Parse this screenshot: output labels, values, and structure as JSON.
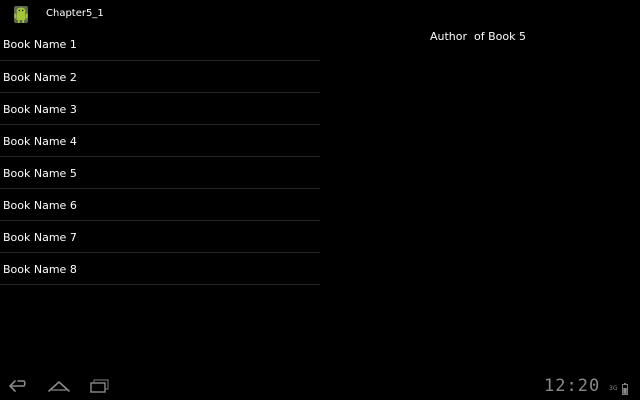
{
  "action_bar": {
    "app_icon": "android-robot-icon",
    "title": "Chapter5_1"
  },
  "book_list": {
    "items": [
      {
        "label": "Book Name 1"
      },
      {
        "label": "Book Name 2"
      },
      {
        "label": "Book Name 3"
      },
      {
        "label": "Book Name 4"
      },
      {
        "label": "Book Name 5"
      },
      {
        "label": "Book Name 6"
      },
      {
        "label": "Book Name 7"
      },
      {
        "label": "Book Name 8"
      }
    ]
  },
  "detail": {
    "author_text": "Author  of Book 5"
  },
  "system_bar": {
    "nav_icons": [
      "back-icon",
      "home-icon",
      "recent-apps-icon"
    ],
    "clock": "12:20",
    "signal": "3G",
    "battery_icon": "battery-icon"
  },
  "colors": {
    "background": "#000000",
    "text": "#ffffff",
    "divider": "#262626",
    "system_text": "#8a8a8a"
  }
}
